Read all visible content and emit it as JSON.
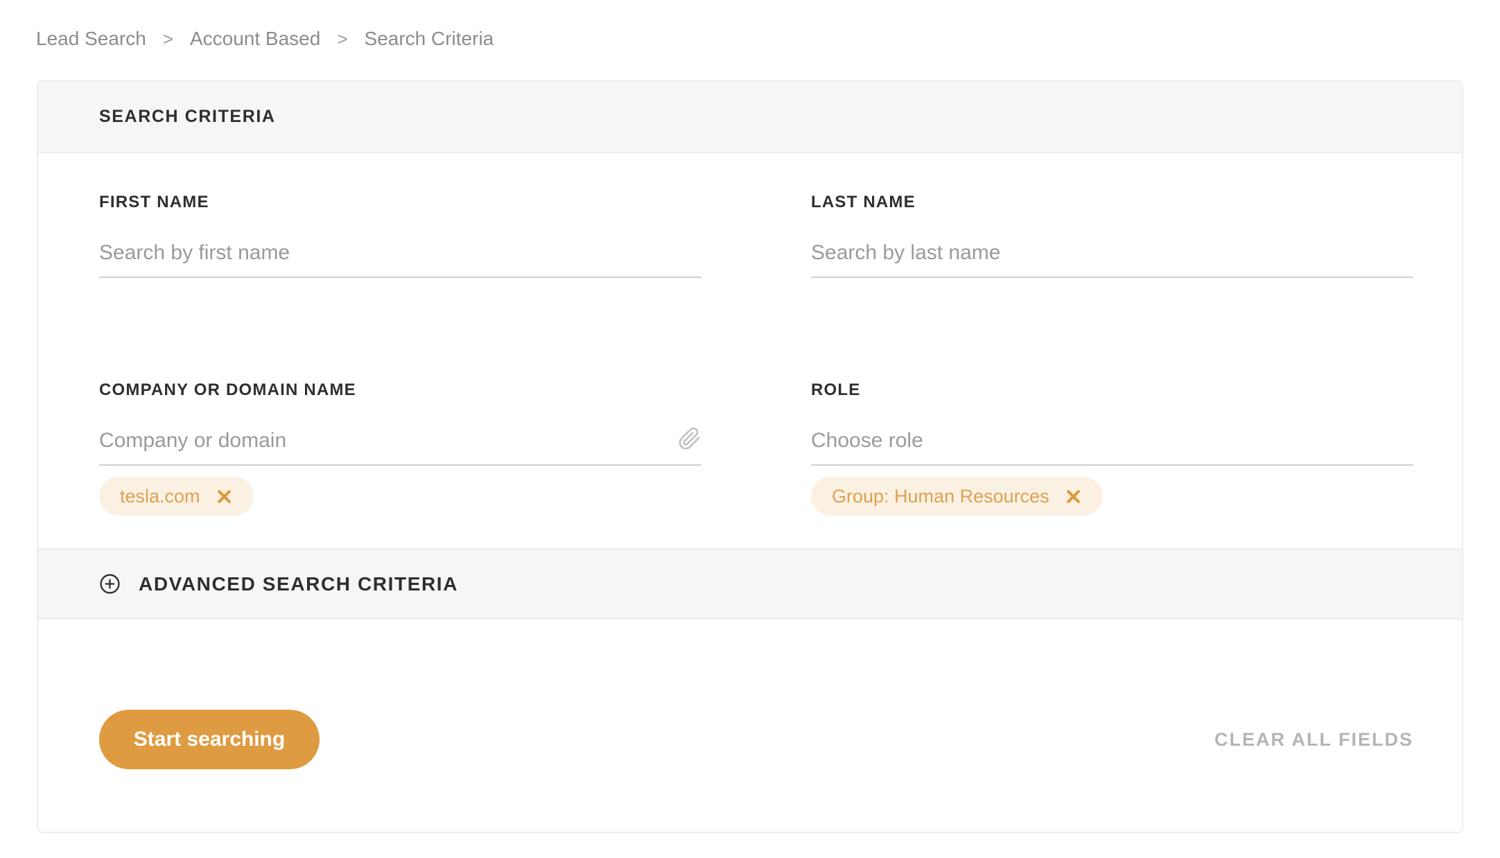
{
  "breadcrumb": {
    "separator": ">",
    "items": [
      {
        "label": "Lead Search"
      },
      {
        "label": "Account Based"
      },
      {
        "label": "Search Criteria"
      }
    ]
  },
  "panel": {
    "title": "SEARCH CRITERIA",
    "fields": {
      "first_name": {
        "label": "FIRST NAME",
        "placeholder": "Search by first name",
        "value": ""
      },
      "last_name": {
        "label": "LAST NAME",
        "placeholder": "Search by last name",
        "value": ""
      },
      "company": {
        "label": "COMPANY OR DOMAIN NAME",
        "placeholder": "Company or domain",
        "value": "",
        "attach_icon": "paperclip-icon",
        "tags": [
          {
            "label": "tesla.com",
            "remove_icon": "x-icon"
          }
        ]
      },
      "role": {
        "label": "ROLE",
        "placeholder": "Choose role",
        "value": "",
        "tags": [
          {
            "label": "Group: Human Resources",
            "remove_icon": "x-icon"
          }
        ]
      }
    },
    "advanced": {
      "icon": "plus-circle-icon",
      "label": "ADVANCED SEARCH CRITERIA"
    },
    "footer": {
      "start_button": "Start searching",
      "clear_button": "CLEAR ALL FIELDS"
    }
  },
  "colors": {
    "accent": "#DF9B41",
    "tag_background": "#FAF1E3",
    "tag_text": "#E0A150",
    "section_band": "#F6F6F5",
    "card_border": "#ECECEC",
    "placeholder_text": "#9A9A9A",
    "label_text": "#2E2E2E",
    "breadcrumb_text": "#8C8C8C",
    "clear_button_text": "#B5B5B5"
  }
}
